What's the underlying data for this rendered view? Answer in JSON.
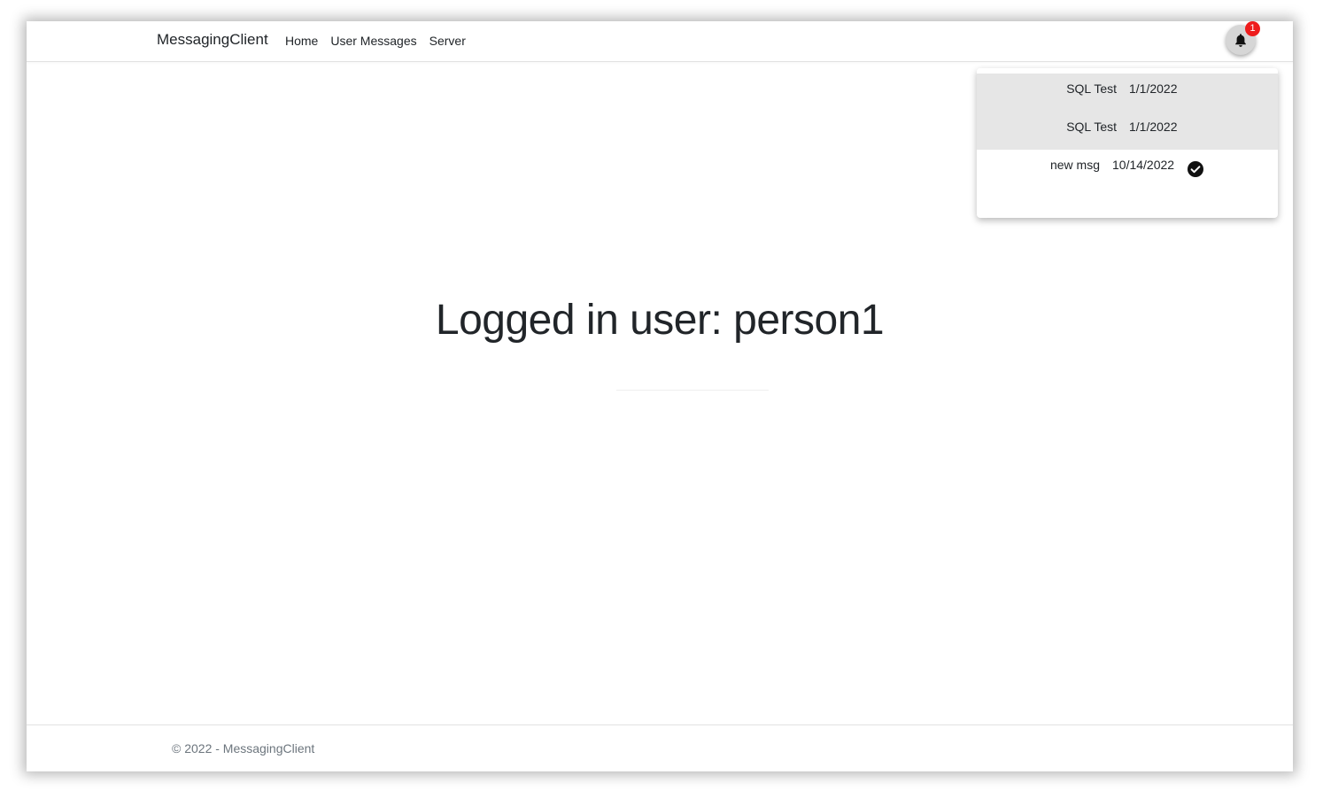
{
  "navbar": {
    "brand": "MessagingClient",
    "links": [
      "Home",
      "User Messages",
      "Server"
    ]
  },
  "notifications": {
    "badge_count": "1",
    "items": [
      {
        "subject": "SQL Test",
        "date": "1/1/2022",
        "state": "read"
      },
      {
        "subject": "SQL Test",
        "date": "1/1/2022",
        "state": "read"
      },
      {
        "subject": "new msg",
        "date": "10/14/2022",
        "state": "unread"
      }
    ]
  },
  "main": {
    "heading": "Logged in user: person1"
  },
  "footer": {
    "text": "© 2022 - MessagingClient"
  },
  "icons": {
    "bell": "bell-icon",
    "check": "check-circle-icon"
  },
  "colors": {
    "badge": "#ee1c1c",
    "read_row": "#e6e6e6",
    "text": "#212529",
    "muted": "#6c757d"
  }
}
